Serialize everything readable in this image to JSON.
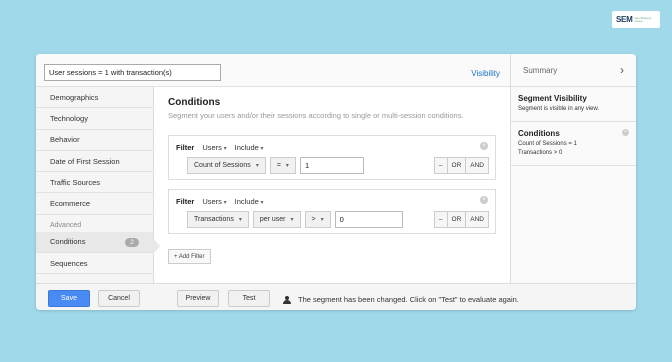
{
  "brand": {
    "logo_text": "SEM",
    "logo_tagline": "Seo Mastery Group"
  },
  "editor": {
    "segment_name": "User sessions = 1 with transaction(s)",
    "visibility_label": "Visibility"
  },
  "nav": {
    "items": [
      {
        "label": "Demographics"
      },
      {
        "label": "Technology"
      },
      {
        "label": "Behavior"
      },
      {
        "label": "Date of First Session"
      },
      {
        "label": "Traffic Sources"
      },
      {
        "label": "Ecommerce"
      }
    ],
    "advanced_label": "Advanced",
    "advanced_items": [
      {
        "label": "Conditions",
        "count": "2"
      },
      {
        "label": "Sequences"
      }
    ]
  },
  "conditions": {
    "title": "Conditions",
    "subtitle": "Segment your users and/or their sessions according to single or multi-session conditions.",
    "filters": [
      {
        "label": "Filter",
        "scope": "Users",
        "mode": "Include",
        "metric": "Count of Sessions",
        "operator": "=",
        "value": "1"
      },
      {
        "label": "Filter",
        "scope": "Users",
        "mode": "Include",
        "metric": "Transactions",
        "per": "per user",
        "operator": ">",
        "value": "0"
      }
    ],
    "logic": {
      "minus": "–",
      "or": "OR",
      "and": "AND"
    },
    "add_filter_label": "+ Add Filter"
  },
  "summary": {
    "title": "Summary",
    "visibility_heading": "Segment Visibility",
    "visibility_text": "Segment is visible in any view.",
    "conditions_heading": "Conditions",
    "conditions_lines": [
      "Count of Sessions = 1",
      "Transactions > 0"
    ]
  },
  "footer": {
    "save": "Save",
    "cancel": "Cancel",
    "preview": "Preview",
    "test": "Test",
    "status": "The segment has been changed. Click on \"Test\" to evaluate again."
  },
  "colors": {
    "background": "#9fd9ea",
    "primary_button": "#4a8af4",
    "link": "#1a73c8"
  }
}
